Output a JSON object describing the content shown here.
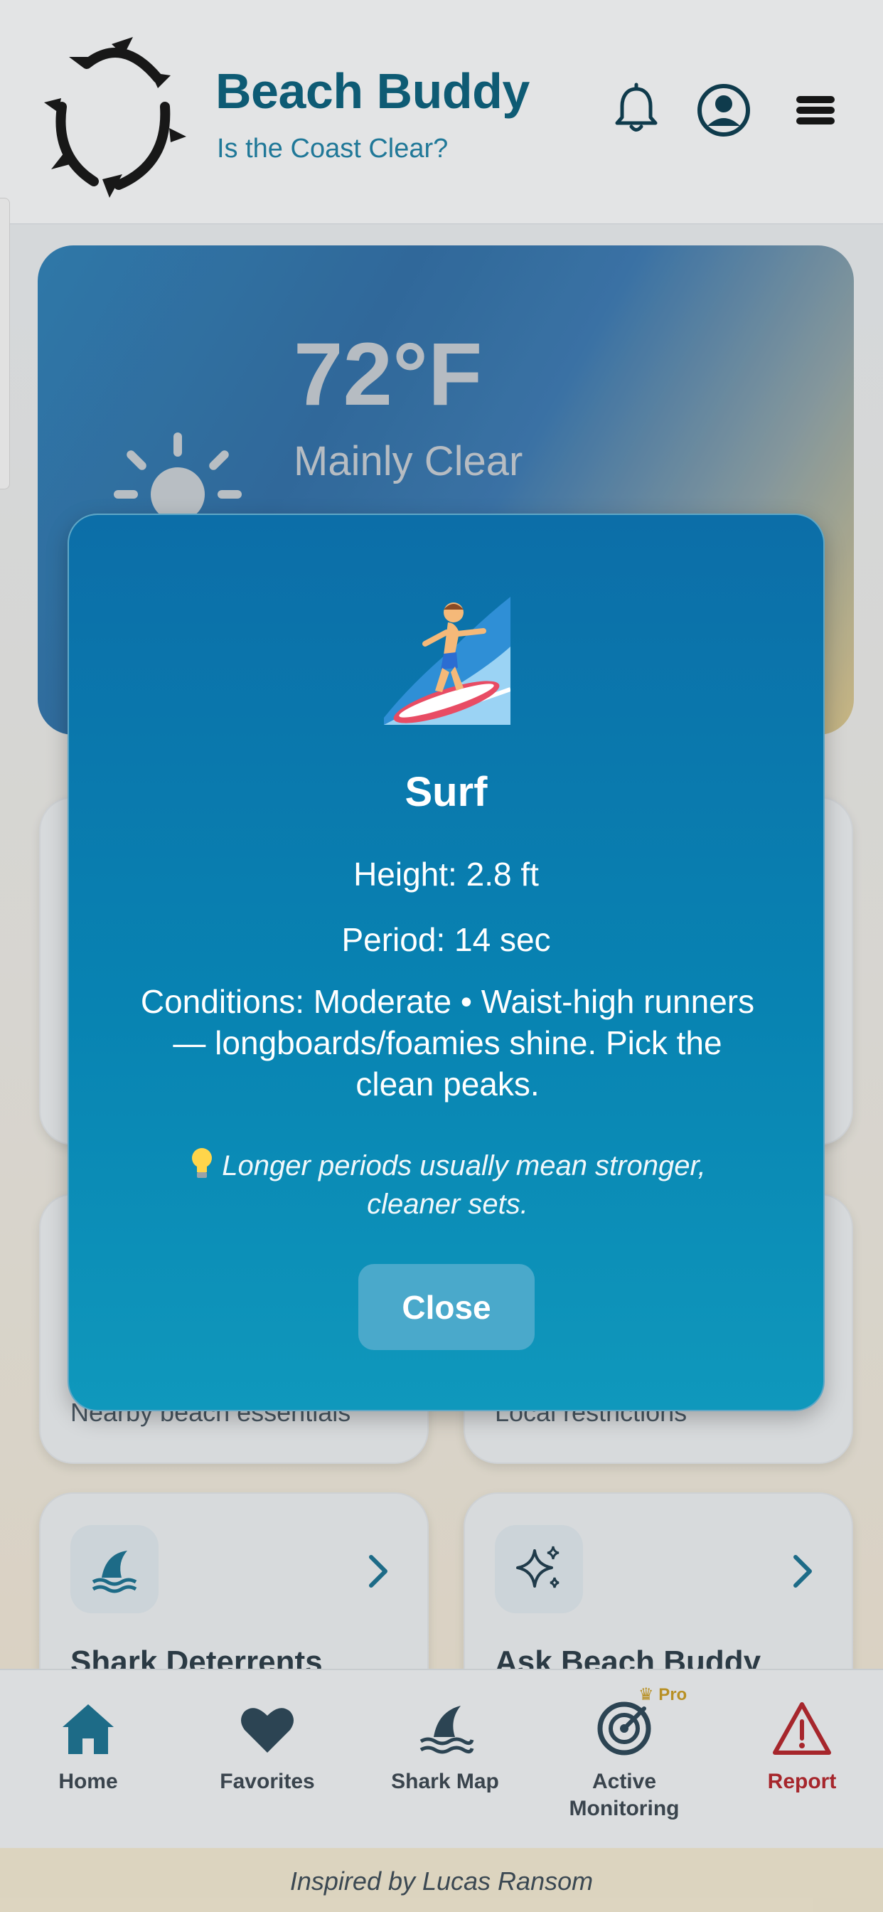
{
  "header": {
    "title": "Beach Buddy",
    "subtitle": "Is the Coast Clear?",
    "icons": [
      "bell-icon",
      "account-icon",
      "menu-icon"
    ]
  },
  "weather": {
    "temperature": "72°F",
    "condition": "Mainly Clear",
    "icon": "sun-icon"
  },
  "cards": [
    {
      "subtitle": "Nearby beach essentials"
    },
    {
      "subtitle": "Local restrictions"
    },
    {
      "title": "Shark Deterrents",
      "icon": "shark-fin-icon"
    },
    {
      "title": "Ask Beach Buddy",
      "icon": "sparkles-icon"
    }
  ],
  "modal": {
    "icon": "surfer-emoji",
    "title": "Surf",
    "height": "Height: 2.8 ft",
    "period": "Period: 14 sec",
    "conditions": "Conditions: Moderate • Waist-high runners — longboards/foamies shine. Pick the clean peaks.",
    "tip": "Longer periods usually mean stronger, cleaner sets.",
    "tip_icon": "lightbulb-icon",
    "close_label": "Close"
  },
  "nav": {
    "items": [
      {
        "label": "Home",
        "icon": "home-icon"
      },
      {
        "label": "Favorites",
        "icon": "heart-icon"
      },
      {
        "label": "Shark Map",
        "icon": "shark-fin-icon"
      },
      {
        "label": "Active Monitoring",
        "icon": "radar-icon"
      },
      {
        "label": "Report",
        "icon": "warning-icon"
      }
    ],
    "pro_badge": "Pro"
  },
  "footer": {
    "text": "Inspired by Lucas Ransom"
  },
  "colors": {
    "brand": "#0a5f7b",
    "modal_top": "#0c6ea8",
    "modal_bottom": "#0f98bc",
    "report": "#b3242b",
    "nav_active": "#1a7190"
  }
}
